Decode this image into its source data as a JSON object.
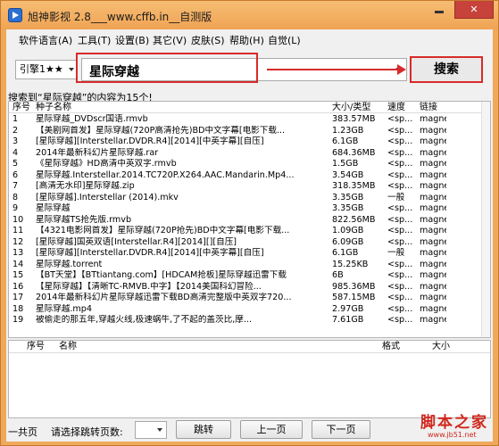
{
  "window": {
    "title": "旭神影视 2.8___www.cffb.in__自测版",
    "close_label": "✕"
  },
  "menu": [
    {
      "label": "软件语言(A)"
    },
    {
      "label": "工具(T)"
    },
    {
      "label": "设置(B)"
    },
    {
      "label": "其它(V)"
    },
    {
      "label": "皮肤(S)"
    },
    {
      "label": "帮助(H)"
    },
    {
      "label": "自觉(L)"
    }
  ],
  "search": {
    "engine": "引擎1★★",
    "query": "星际穿越",
    "button_label": "搜索"
  },
  "result_summary": "搜索到“星际穿越”的内容为15个!",
  "results": {
    "headers": {
      "index": "序号",
      "name": "种子名称",
      "size": "大小/类型",
      "speed": "速度",
      "link": "链接"
    },
    "rows": [
      {
        "index": "1",
        "name": "星际穿越_DVDscr国语.rmvb",
        "size": "383.57MB",
        "speed": "<sp...",
        "link": "magne..."
      },
      {
        "index": "2",
        "name": "【美剧网首发】星际穿越(720P高清抢先)BD中文字幕[电影下载...",
        "size": "1.23GB",
        "speed": "<sp...",
        "link": "magne..."
      },
      {
        "index": "3",
        "name": "[星际穿越][Interstellar.DVDR.R4][2014][中英字幕][自压]",
        "size": "6.1GB",
        "speed": "<sp...",
        "link": "magne..."
      },
      {
        "index": "4",
        "name": "2014年最新科幻片星际穿越.rar",
        "size": "684.36MB",
        "speed": "<sp...",
        "link": "magne..."
      },
      {
        "index": "5",
        "name": "《星际穿越》HD高清中英双字.rmvb",
        "size": "1.5GB",
        "speed": "<sp...",
        "link": "magne..."
      },
      {
        "index": "6",
        "name": "星际穿越.Interstellar.2014.TC720P.X264.AAC.Mandarin.Mp4...",
        "size": "3.54GB",
        "speed": "<sp...",
        "link": "magne..."
      },
      {
        "index": "7",
        "name": "[高清无水印]星际穿越.zip",
        "size": "318.35MB",
        "speed": "<sp...",
        "link": "magne..."
      },
      {
        "index": "8",
        "name": "[星际穿越].Interstellar (2014).mkv",
        "size": "3.35GB",
        "speed": "一般",
        "link": "magne..."
      },
      {
        "index": "9",
        "name": "星际穿越",
        "size": "3.35GB",
        "speed": "<sp...",
        "link": "magne..."
      },
      {
        "index": "10",
        "name": "星际穿越TS抢先版.rmvb",
        "size": "822.56MB",
        "speed": "<sp...",
        "link": "magne..."
      },
      {
        "index": "11",
        "name": "【4321电影网首发】星际穿越(720P抢先)BD中文字幕[电影下载...",
        "size": "1.09GB",
        "speed": "<sp...",
        "link": "magne..."
      },
      {
        "index": "12",
        "name": "[星际穿越]国英双语[Interstellar.R4][2014][][自压]",
        "size": "6.09GB",
        "speed": "<sp...",
        "link": "magne..."
      },
      {
        "index": "13",
        "name": "[星际穿越][Interstellar.DVDR.R4][2014][中英字幕][自压]",
        "size": "6.1GB",
        "speed": "一般",
        "link": "magne..."
      },
      {
        "index": "14",
        "name": "星际穿越.torrent",
        "size": "15.25KB",
        "speed": "<sp...",
        "link": "magne..."
      },
      {
        "index": "15",
        "name": "【BT天堂】【BTtiantang.com】[HDCAM抢板]星际穿越迅雷下载",
        "size": "6B",
        "speed": "<sp...",
        "link": "magne..."
      },
      {
        "index": "16",
        "name": "【星际穿越】【清晰TC-RMVB.中字】【2014美国科幻冒险...",
        "size": "985.36MB",
        "speed": "<sp...",
        "link": "magne..."
      },
      {
        "index": "17",
        "name": "2014年最新科幻片星际穿越迅雷下载BD高清完整版中英双字720...",
        "size": "587.15MB",
        "speed": "<sp...",
        "link": "magne..."
      },
      {
        "index": "18",
        "name": "星际穿越.mp4",
        "size": "2.97GB",
        "speed": "<sp...",
        "link": "magne..."
      },
      {
        "index": "19",
        "name": "被偷走的那五年,穿越火线,极速蜗牛,了不起的盖茨比,摩...",
        "size": "7.61GB",
        "speed": "<sp...",
        "link": "magne..."
      }
    ]
  },
  "downloads": {
    "headers": {
      "index": "序号",
      "name": "名称",
      "format": "格式",
      "size": "大小"
    }
  },
  "pager": {
    "total_prefix": "一共页",
    "select_prompt": "请选择跳转页数:",
    "jump_label": "跳转",
    "prev_label": "上一页",
    "next_label": "下一页"
  },
  "watermark": {
    "title": "脚本之家",
    "url": "www.jb51.net"
  },
  "colors": {
    "accent": "#d82a2a",
    "title_bar": "#f0a85a",
    "watermark": "#d0271d"
  },
  "icons": [
    "app-icon",
    "dropdown-arrow-icon",
    "arrow-right-icon",
    "minimize-icon",
    "close-icon"
  ]
}
